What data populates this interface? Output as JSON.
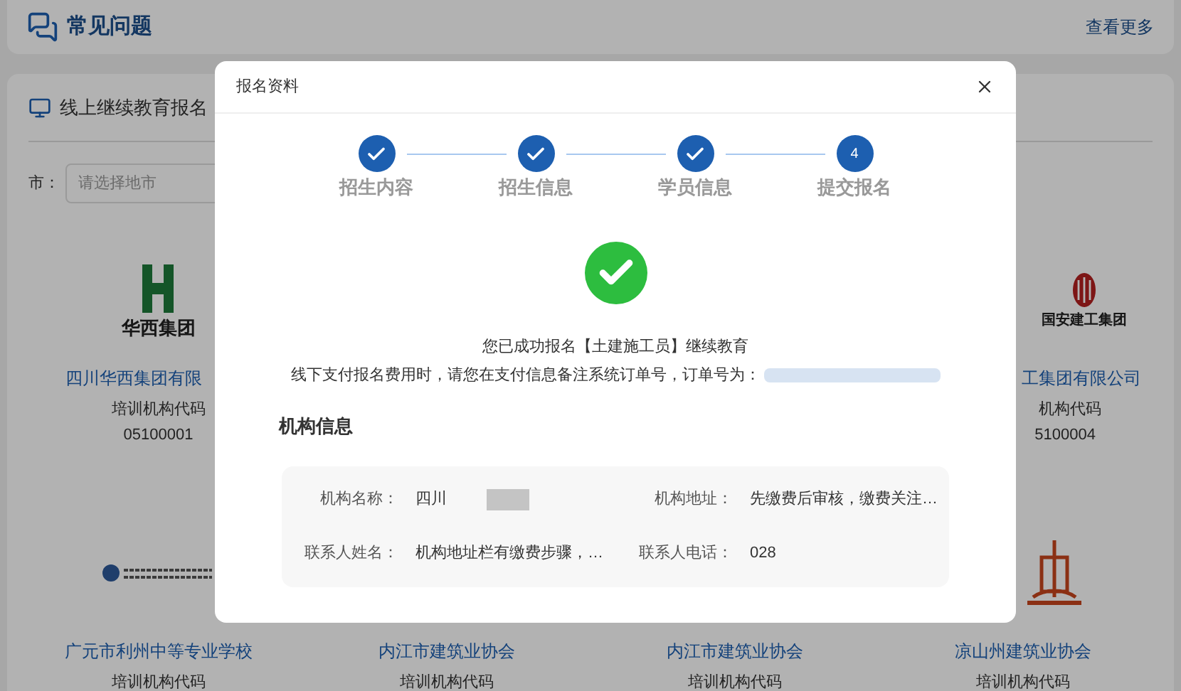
{
  "header": {
    "title": "常见问题",
    "more_link": "查看更多"
  },
  "section": {
    "title": "线上继续教育报名",
    "city_filter": {
      "label": "市：",
      "placeholder": "请选择地市"
    }
  },
  "card_rows": [
    {
      "cards": [
        {
          "kind": "h-mark",
          "logo_text": "华西集团",
          "name": "四川华西集团有限",
          "code_label": "培训机构代码",
          "code": "05100001"
        },
        {
          "kind": "emblem",
          "logo_text": "国安建工集团",
          "name": "工集团有限公司",
          "code_label": "机构代码",
          "code": "5100004"
        }
      ]
    },
    {
      "cards": [
        {
          "kind": "school",
          "name": "广元市利州中等专业学校",
          "code_label": "培训机构代码"
        },
        {
          "name": "内江市建筑业协会",
          "code_label": "培训机构代码"
        },
        {
          "name": "内江市建筑业协会",
          "code_label": "培训机构代码"
        },
        {
          "kind": "tower",
          "name": "凉山州建筑业协会",
          "code_label": "培训机构代码"
        }
      ]
    }
  ],
  "dialog": {
    "title": "报名资料",
    "steps": [
      {
        "label": "招生内容",
        "done": true
      },
      {
        "label": "招生信息",
        "done": true
      },
      {
        "label": "学员信息",
        "done": true
      },
      {
        "label": "提交报名",
        "done": false,
        "number": "4"
      }
    ],
    "message": "您已成功报名【土建施工员】继续教育",
    "payment_note": "线下支付报名费用时，请您在支付信息备注系统订单号，订单号为：",
    "org_heading": "机构信息",
    "org_fields": [
      {
        "label": "机构名称：",
        "value": "四川",
        "redacted": true
      },
      {
        "label": "机构地址：",
        "value": "先缴费后审核，缴费关注…"
      },
      {
        "label": "联系人姓名：",
        "value": "机构地址栏有缴费步骤，…"
      },
      {
        "label": "联系人电话：",
        "value": "028"
      }
    ]
  }
}
